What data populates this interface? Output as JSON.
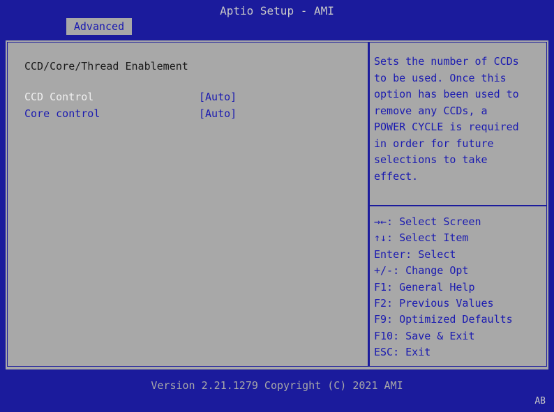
{
  "header": {
    "title": "Aptio Setup - AMI",
    "tabs": [
      {
        "label": "Advanced"
      }
    ]
  },
  "main": {
    "heading": "CCD/Core/Thread Enablement",
    "items": [
      {
        "label": "CCD Control",
        "value": "[Auto]"
      },
      {
        "label": "Core control",
        "value": "[Auto]"
      }
    ],
    "selected_index": 0
  },
  "help": {
    "lines": [
      "Sets the number of CCDs",
      "to be used. Once this",
      "option has been used to",
      "remove any CCDs, a",
      "POWER CYCLE is required",
      "in order for future",
      "selections to take",
      "effect."
    ]
  },
  "keys": {
    "lines": [
      "→←: Select Screen",
      "↑↓: Select Item",
      "Enter: Select",
      "+/-: Change Opt",
      "F1: General Help",
      "F2: Previous Values",
      "F9: Optimized Defaults",
      "F10: Save & Exit",
      "ESC: Exit"
    ]
  },
  "footer": {
    "version": "Version 2.21.1279 Copyright (C) 2021 AMI",
    "corner": "AB"
  },
  "colors": {
    "bios_blue": "#1b1b9c",
    "panel_gray": "#a8a8a8",
    "text_blue": "#1a1ab0",
    "selected_white": "#f0f0f0"
  }
}
